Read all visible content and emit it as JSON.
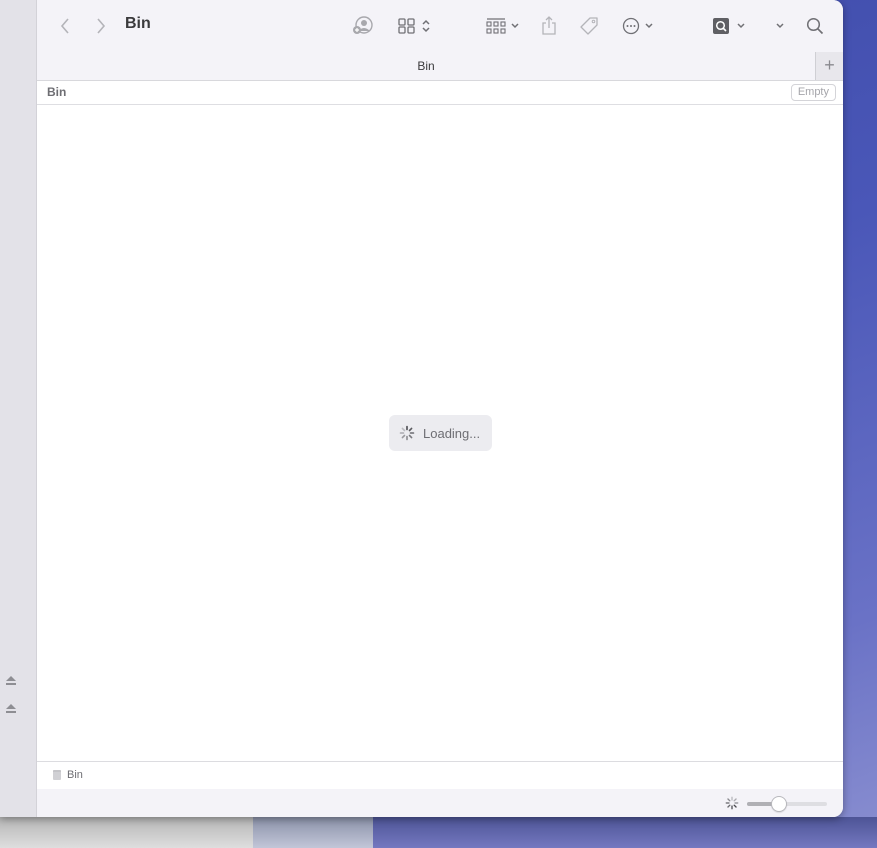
{
  "window": {
    "title": "Bin",
    "toolbar": {
      "back_icon": "chevron-left-icon",
      "forward_icon": "chevron-right-icon",
      "share_user_icon": "person-add-icon",
      "view_icon": "grid-view-icon",
      "group_icon": "group-by-icon",
      "share_icon": "share-icon",
      "tag_icon": "tag-icon",
      "more_icon": "ellipsis-circle-icon",
      "quicklook_icon": "preview-search-icon",
      "overflow_icon": "chevron-down-icon",
      "search_icon": "search-icon"
    },
    "tabs": [
      {
        "label": "Bin"
      }
    ],
    "tab_add_label": "+",
    "path_title": "Bin",
    "empty_button_label": "Empty",
    "loading_text": "Loading...",
    "status": {
      "item_label": "Bin"
    },
    "icon_size_slider": {
      "value_fraction": 0.39
    }
  }
}
